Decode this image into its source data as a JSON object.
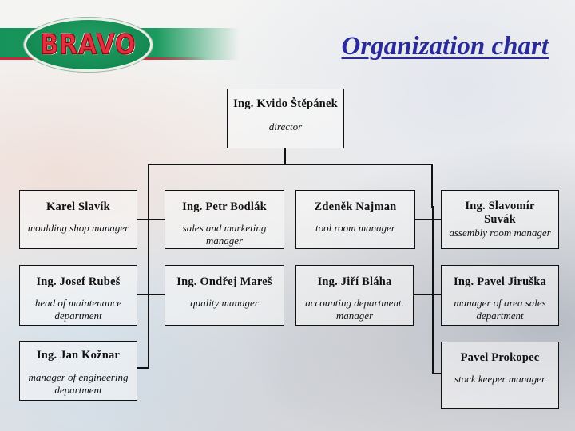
{
  "header": {
    "logo_text": "BRAVO",
    "title": "Organization chart"
  },
  "colors": {
    "title": "#2a2a9a",
    "logo_green": "#138a52",
    "logo_red": "#e0303e",
    "box_border": "#111111"
  },
  "director": {
    "name": "Ing. Kvido Štěpánek",
    "role": "director"
  },
  "left_column": [
    {
      "name": "Karel Slavík",
      "role": "moulding shop manager"
    },
    {
      "name": "Ing. Josef Rubeš",
      "role": "head of maintenance department"
    },
    {
      "name": "Ing. Jan Kožnar",
      "role": "manager of engineering department"
    }
  ],
  "left_inner_column": [
    {
      "name": "Ing. Petr Bodlák",
      "role": "sales and marketing manager"
    },
    {
      "name": "Ing. Ondřej Mareš",
      "role": "quality manager"
    }
  ],
  "right_inner_column": [
    {
      "name": "Zdeněk Najman",
      "role": "tool room manager"
    },
    {
      "name": "Ing. Jiří Bláha",
      "role": "accounting department. manager"
    }
  ],
  "right_column": [
    {
      "name": "Ing. Slavomír Suvák",
      "role": "assembly room manager"
    },
    {
      "name": "Ing. Pavel Jiruška",
      "role": "manager of area sales department"
    },
    {
      "name": "Pavel Prokopec",
      "role": "stock keeper manager"
    }
  ]
}
